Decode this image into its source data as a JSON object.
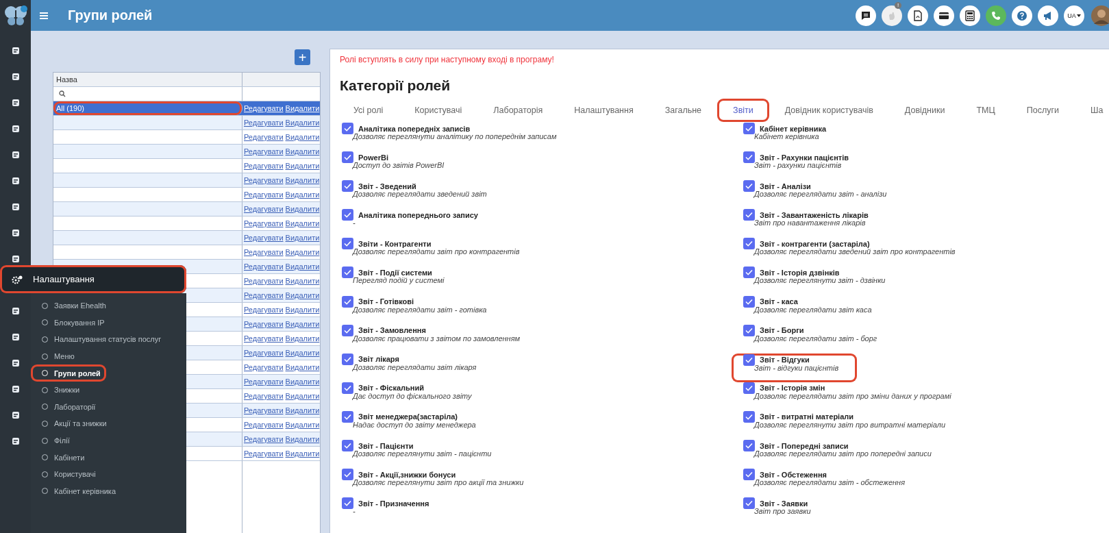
{
  "app_bar": {
    "title": "Групи ролей",
    "notification_badge": "!",
    "language": "UA"
  },
  "add_button": "+",
  "role_groups": {
    "column": "Назва",
    "rows": [
      {
        "name": "All (190)",
        "selected": true,
        "highlighted": true,
        "edit": "Редагувати",
        "delete": "Видалити"
      },
      {
        "selected": false,
        "highlighted": false,
        "edit": "Редагувати",
        "delete": "Видалити"
      },
      {
        "selected": false,
        "highlighted": false,
        "edit": "Редагувати",
        "delete": "Видалити"
      },
      {
        "selected": false,
        "highlighted": false,
        "edit": "Редагувати",
        "delete": "Видалити"
      },
      {
        "selected": false,
        "highlighted": false,
        "edit": "Редагувати",
        "delete": "Видалити"
      },
      {
        "selected": false,
        "highlighted": false,
        "edit": "Редагувати",
        "delete": "Видалити"
      },
      {
        "selected": false,
        "highlighted": false,
        "edit": "Редагувати",
        "delete": "Видалити"
      },
      {
        "selected": false,
        "highlighted": false,
        "edit": "Редагувати",
        "delete": "Видалити"
      },
      {
        "selected": false,
        "highlighted": false,
        "edit": "Редагувати",
        "delete": "Видалити"
      },
      {
        "selected": false,
        "highlighted": false,
        "edit": "Редагувати",
        "delete": "Видалити"
      },
      {
        "selected": false,
        "highlighted": false,
        "edit": "Редагувати",
        "delete": "Видалити"
      },
      {
        "selected": false,
        "highlighted": false,
        "edit": "Редагувати",
        "delete": "Видалити"
      },
      {
        "selected": false,
        "highlighted": false,
        "edit": "Редагувати",
        "delete": "Видалити"
      },
      {
        "selected": false,
        "highlighted": false,
        "edit": "Редагувати",
        "delete": "Видалити"
      },
      {
        "selected": false,
        "highlighted": false,
        "edit": "Редагувати",
        "delete": "Видалити"
      },
      {
        "selected": false,
        "highlighted": false,
        "edit": "Редагувати",
        "delete": "Видалити"
      },
      {
        "selected": false,
        "highlighted": false,
        "edit": "Редагувати",
        "delete": "Видалити"
      },
      {
        "selected": false,
        "highlighted": false,
        "edit": "Редагувати",
        "delete": "Видалити"
      },
      {
        "selected": false,
        "highlighted": false,
        "edit": "Редагувати",
        "delete": "Видалити"
      },
      {
        "selected": false,
        "highlighted": false,
        "edit": "Редагувати",
        "delete": "Видалити"
      },
      {
        "selected": false,
        "highlighted": false,
        "edit": "Редагувати",
        "delete": "Видалити"
      },
      {
        "selected": false,
        "highlighted": false,
        "edit": "Редагувати",
        "delete": "Видалити"
      },
      {
        "selected": false,
        "highlighted": false,
        "edit": "Редагувати",
        "delete": "Видалити"
      },
      {
        "selected": false,
        "highlighted": false,
        "edit": "Редагувати",
        "delete": "Видалити"
      },
      {
        "selected": false,
        "highlighted": false,
        "edit": "Редагувати",
        "delete": "Видалити"
      }
    ]
  },
  "settings_menu": {
    "title": "Налаштування",
    "highlighted": true,
    "items": [
      {
        "label": "Заявки Ehealth",
        "selected": false,
        "highlighted": false
      },
      {
        "label": "Блокування IP",
        "selected": false,
        "highlighted": false
      },
      {
        "label": "Налаштування статусів послуг",
        "selected": false,
        "highlighted": false
      },
      {
        "label": "Меню",
        "selected": false,
        "highlighted": false
      },
      {
        "label": "Групи ролей",
        "selected": true,
        "highlighted": true
      },
      {
        "label": "Знижки",
        "selected": false,
        "highlighted": false
      },
      {
        "label": "Лабораторії",
        "selected": false,
        "highlighted": false
      },
      {
        "label": "Акції та знижки",
        "selected": false,
        "highlighted": false
      },
      {
        "label": "Філії",
        "selected": false,
        "highlighted": false
      },
      {
        "label": "Кабінети",
        "selected": false,
        "highlighted": false
      },
      {
        "label": "Користувачі",
        "selected": false,
        "highlighted": false
      },
      {
        "label": "Кабінет керівника",
        "selected": false,
        "highlighted": false
      }
    ]
  },
  "notice": "Ролі вступлять в силу при наступному вході в програму!",
  "heading": "Категорії ролей",
  "tabs": [
    {
      "label": "Усі ролі",
      "selected": false,
      "highlighted": false
    },
    {
      "label": "Користувачі",
      "selected": false,
      "highlighted": false
    },
    {
      "label": "Лабораторія",
      "selected": false,
      "highlighted": false
    },
    {
      "label": "Налаштування",
      "selected": false,
      "highlighted": false
    },
    {
      "label": "Загальне",
      "selected": false,
      "highlighted": false
    },
    {
      "label": "Звіти",
      "selected": true,
      "highlighted": true
    },
    {
      "label": "Довідник користувачів",
      "selected": false,
      "highlighted": false
    },
    {
      "label": "Довідники",
      "selected": false,
      "highlighted": false
    },
    {
      "label": "ТМЦ",
      "selected": false,
      "highlighted": false
    },
    {
      "label": "Послуги",
      "selected": false,
      "highlighted": false
    },
    {
      "label": "Ша",
      "selected": false,
      "highlighted": false
    }
  ],
  "permissions": {
    "left": [
      {
        "title": "Аналітика попередніх записів",
        "description": "Дозволяє переглянути аналітику по попереднім записам",
        "checked": true,
        "highlighted": false
      },
      {
        "title": "PowerBi",
        "description": "Доступ до звітів PowerBI",
        "checked": true,
        "highlighted": false
      },
      {
        "title": "Звіт - Зведений",
        "description": "Дозволяє переглядати зведений звіт",
        "checked": true,
        "highlighted": false
      },
      {
        "title": "Аналітика попереднього запису",
        "description": "-",
        "checked": true,
        "highlighted": false
      },
      {
        "title": "Звіти - Контрагенти",
        "description": "Дозволяє переглядати звіт про контрагентів",
        "checked": true,
        "highlighted": false
      },
      {
        "title": "Звіт - Події системи",
        "description": "Перегляд подій у системі",
        "checked": true,
        "highlighted": false
      },
      {
        "title": "Звіт - Готівкові",
        "description": "Дозволяє переглядати звіт - готівка",
        "checked": true,
        "highlighted": false
      },
      {
        "title": "Звіт - Замовлення",
        "description": "Дозволяє працювати з звітом по замовленням",
        "checked": true,
        "highlighted": false
      },
      {
        "title": "Звіт лікаря",
        "description": "Дозволяє переглядати звіт лікаря",
        "checked": true,
        "highlighted": false
      },
      {
        "title": "Звіт - Фіскальний",
        "description": "Дає доступ до фіскального звіту",
        "checked": true,
        "highlighted": false
      },
      {
        "title": "Звіт менеджера(застаріла)",
        "description": "Надає доступ до звіту менеджера",
        "checked": true,
        "highlighted": false
      },
      {
        "title": "Звіт - Пацієнти",
        "description": "Дозволяє переглянути звіт - пацієнти",
        "checked": true,
        "highlighted": false
      },
      {
        "title": "Звіт - Акції,знижки бонуси",
        "description": "Дозволяє переглянути звіт про акції та знижки",
        "checked": true,
        "highlighted": false
      },
      {
        "title": "Звіт - Призначення",
        "description": "-",
        "checked": true,
        "highlighted": false
      }
    ],
    "right": [
      {
        "title": "Кабінет керівника",
        "description": "Кабінет керівника",
        "checked": true,
        "highlighted": false
      },
      {
        "title": "Звіт - Рахунки пацієнтів",
        "description": "Звіт - рахунки пацієнтів",
        "checked": true,
        "highlighted": false
      },
      {
        "title": "Звіт - Аналізи",
        "description": "Дозволяє переглядати звіт - аналізи",
        "checked": true,
        "highlighted": false
      },
      {
        "title": "Звіт - Завантаженість лікарів",
        "description": "Звіт про навантаження лікарів",
        "checked": true,
        "highlighted": false
      },
      {
        "title": "Звіт - контрагенти (застаріла)",
        "description": "Дозволяє переглядати зведений звіт про контрагентів",
        "checked": true,
        "highlighted": false
      },
      {
        "title": "Звіт - Історія дзвінків",
        "description": "Дозволяє переглянути звіт - дзвінки",
        "checked": true,
        "highlighted": false
      },
      {
        "title": "Звіт - каса",
        "description": "Дозволяє переглядати звіт каса",
        "checked": true,
        "highlighted": false
      },
      {
        "title": "Звіт - Борги",
        "description": "Дозволяє переглядати звіт - борг",
        "checked": true,
        "highlighted": false
      },
      {
        "title": "Звіт - Відгуки",
        "description": "Звіт - відгуки пацієнтів",
        "checked": true,
        "highlighted": true
      },
      {
        "title": "Звіт - Історія змін",
        "description": "Дозволяє переглядати звіт про зміни даних у програмі",
        "checked": true,
        "highlighted": false
      },
      {
        "title": "Звіт - витратні матеріали",
        "description": "Дозволяє переглянути звіт про витратні матеріали",
        "checked": true,
        "highlighted": false
      },
      {
        "title": "Звіт - Попередні записи",
        "description": "Дозволяє переглядати звіт про попередні записи",
        "checked": true,
        "highlighted": false
      },
      {
        "title": "Звіт - Обстеження",
        "description": "Дозволяє переглядати звіт - обстеження",
        "checked": true,
        "highlighted": false
      },
      {
        "title": "Звіт - Заявки",
        "description": "Звіт про заявки",
        "checked": true,
        "highlighted": false
      }
    ]
  }
}
